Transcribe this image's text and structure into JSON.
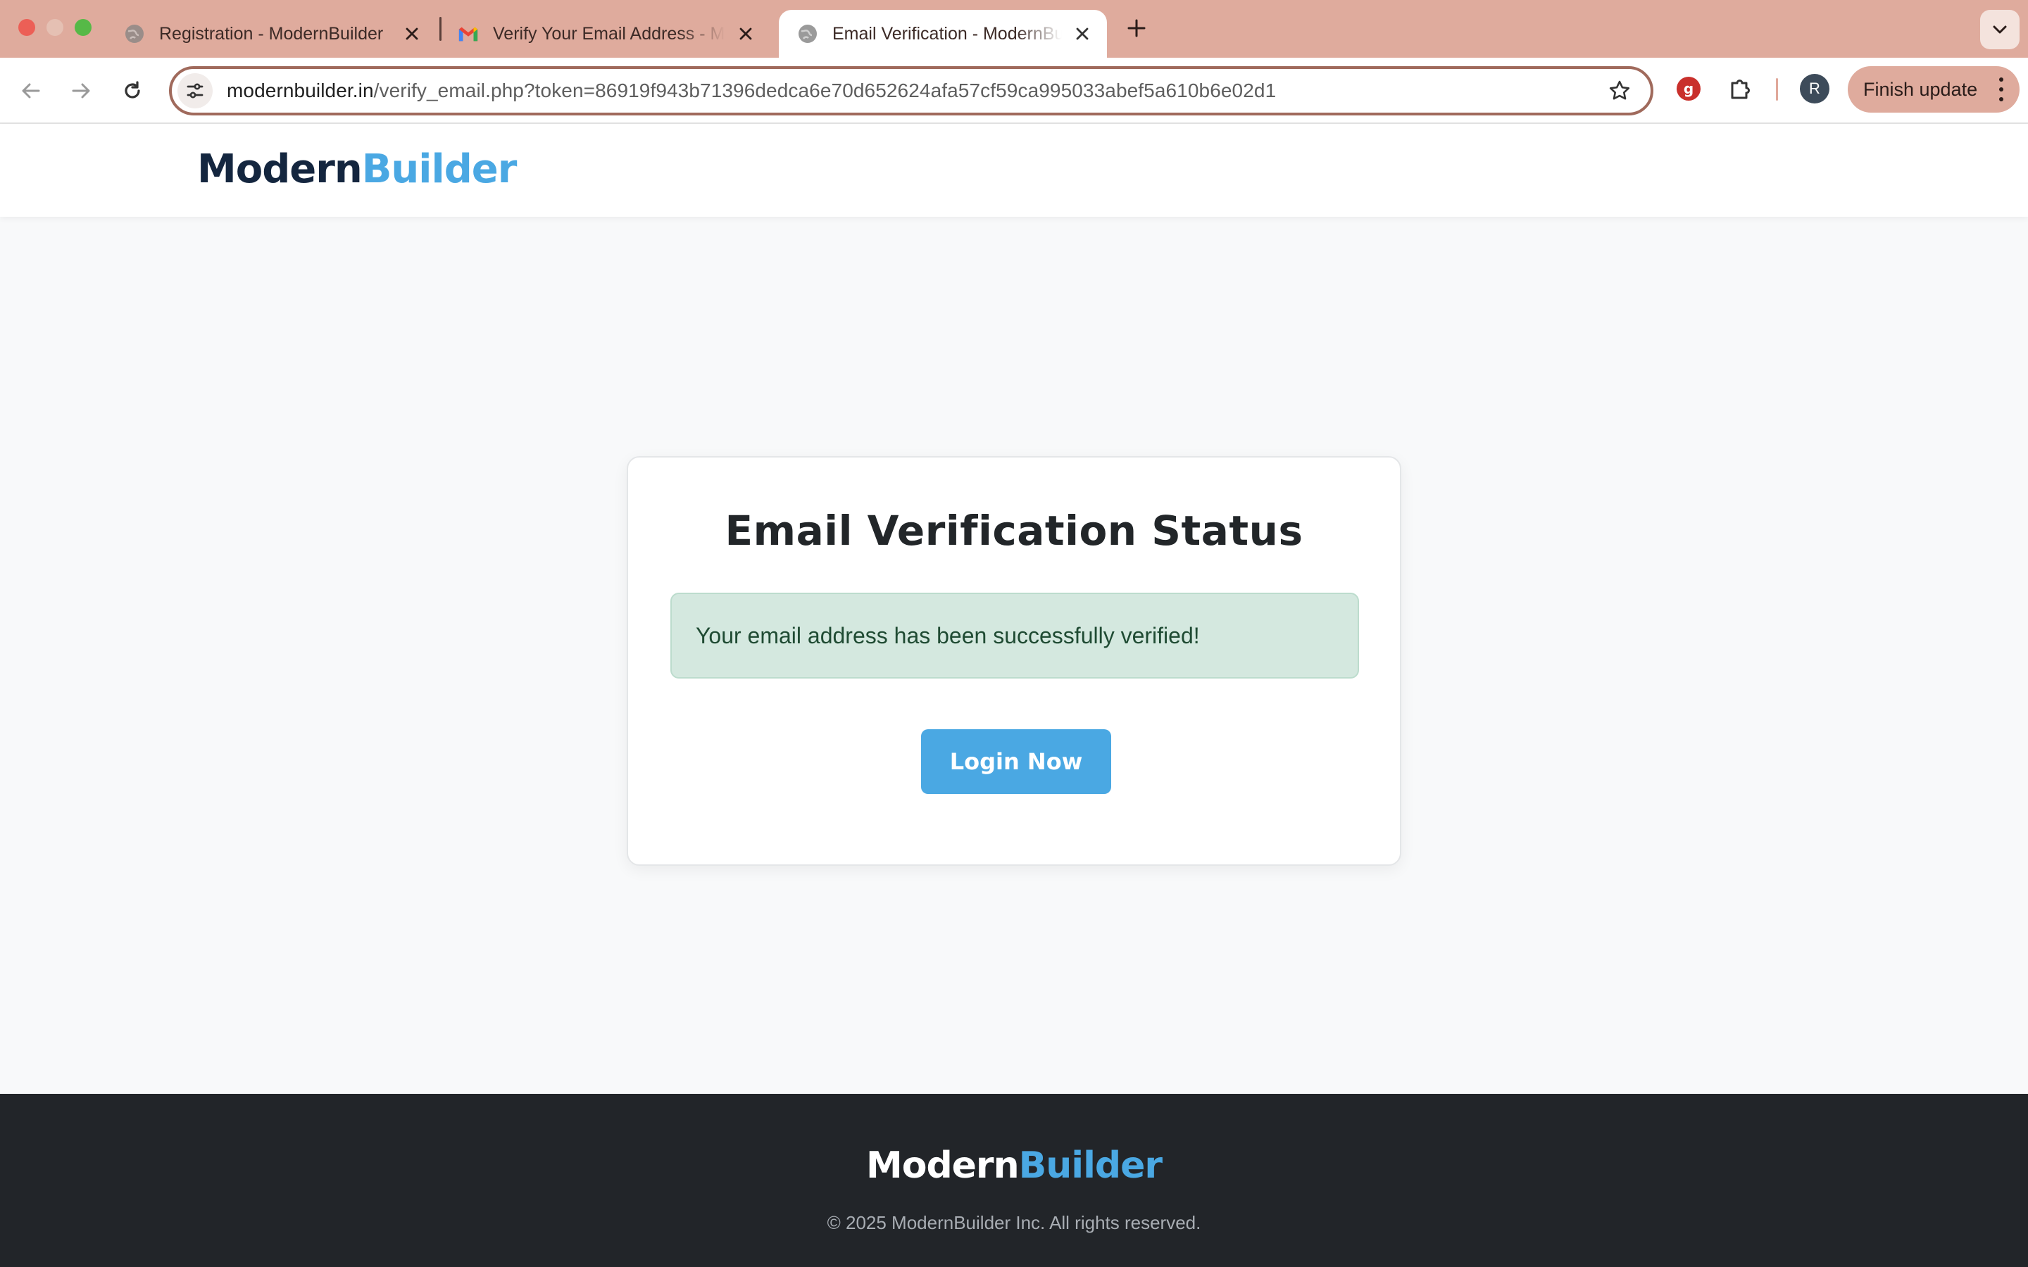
{
  "browser": {
    "tabs": [
      {
        "title": "Registration - ModernBuilder",
        "favicon": "globe-icon",
        "active": false
      },
      {
        "title": "Verify Your Email Address - M",
        "favicon": "gmail-icon",
        "active": false
      },
      {
        "title": "Email Verification - ModernBu",
        "favicon": "globe-icon",
        "active": true
      }
    ],
    "url_host": "modernbuilder.in",
    "url_path": "/verify_email.php?token=86919f943b71396dedca6e70d652624afa57cf59ca995033abef5a610b6e02d1",
    "profile_initial": "R",
    "finish_update_label": "Finish update"
  },
  "header": {
    "logo_part1": "Modern",
    "logo_part2": "Builder"
  },
  "card": {
    "title": "Email Verification Status",
    "message": "Your email address has been successfully verified!",
    "button_label": "Login Now"
  },
  "footer": {
    "logo_part1": "Modern",
    "logo_part2": "Builder",
    "copyright": "© 2025 ModernBuilder Inc. All rights reserved."
  },
  "colors": {
    "brand_dark": "#14263f",
    "brand_accent": "#4aa8e3",
    "success_bg": "#d4e8df",
    "success_text": "#1f4b33",
    "footer_bg": "#222529"
  }
}
